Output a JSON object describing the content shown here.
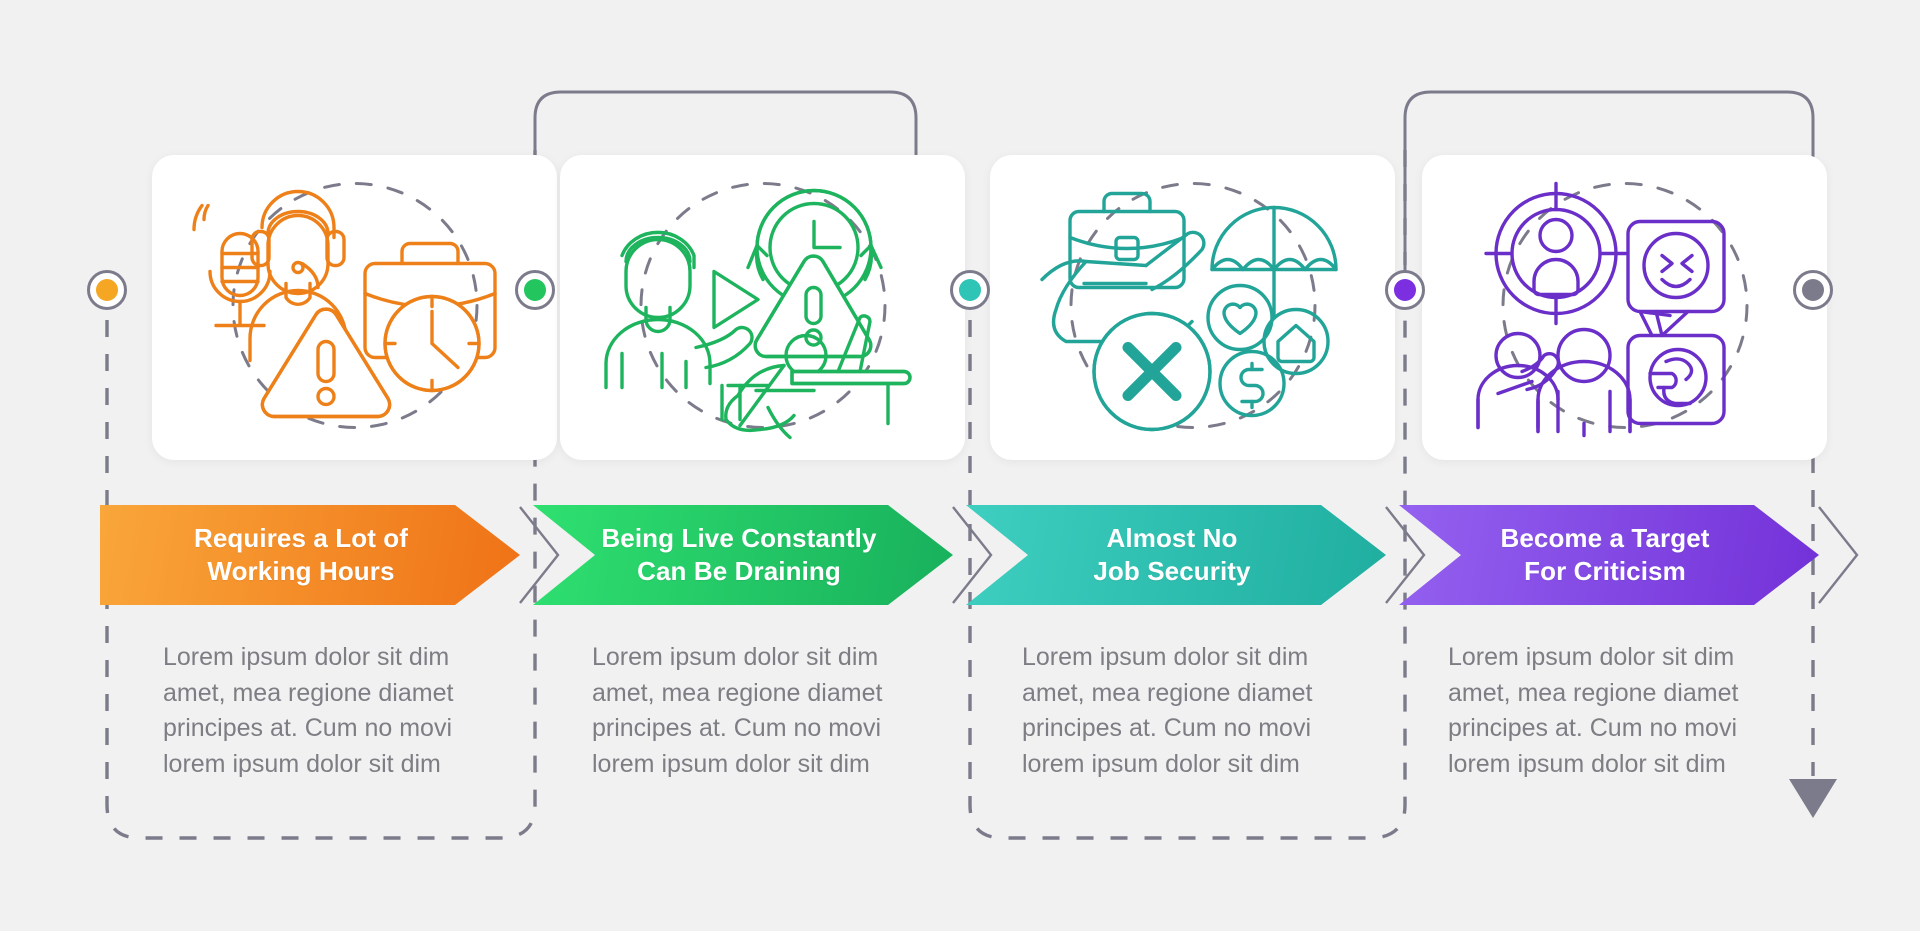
{
  "background_color": "#f1f1f1",
  "steps": [
    {
      "index": 1,
      "title_line1": "Requires a Lot of",
      "title_line2": "Working Hours",
      "description": "Lorem ipsum dolor sit dim amet, mea regione diamet principes at. Cum no movi lorem ipsum dolor sit dim",
      "accent_color": "#f58220",
      "gradient_from": "#f9a63a",
      "gradient_to": "#ef7216",
      "node_color": "#f5a623",
      "icon_name": "headset-operator-briefcase-clock-warning-icon"
    },
    {
      "index": 2,
      "title_line1": "Being Live Constantly",
      "title_line2": "Can Be Draining",
      "description": "Lorem ipsum dolor sit dim amet, mea regione diamet principes at. Cum no movi lorem ipsum dolor sit dim",
      "accent_color": "#22b573",
      "gradient_from": "#2fe070",
      "gradient_to": "#18b05c",
      "node_color": "#22c55e",
      "icon_name": "exhausted-streamer-clock-warning-icon"
    },
    {
      "index": 3,
      "title_line1": "Almost No",
      "title_line2": "Job Security",
      "description": "Lorem ipsum dolor sit dim amet, mea regione diamet principes at. Cum no movi lorem ipsum dolor sit dim",
      "accent_color": "#27bdb0",
      "gradient_from": "#3ecfc0",
      "gradient_to": "#1fae9f",
      "node_color": "#2ec4b6",
      "icon_name": "briefcase-insurance-umbrella-cross-icon"
    },
    {
      "index": 4,
      "title_line1": "Become a Target",
      "title_line2": "For Criticism",
      "description": "Lorem ipsum dolor sit dim amet, mea regione diamet principes at. Cum no movi lorem ipsum dolor sit dim",
      "accent_color": "#7b3fe4",
      "gradient_from": "#9461f0",
      "gradient_to": "#7331d8",
      "node_color": "#7b2fe0",
      "icon_name": "target-person-criticism-bubbles-icon"
    }
  ],
  "end_node": {
    "node_color": "#7b7b8b",
    "icon_name": "end-node-dot"
  },
  "flow_arrow": {
    "icon_name": "down-triangle-arrow-icon",
    "color": "#7b7b8b"
  },
  "connector_color": "#7b7b8b"
}
